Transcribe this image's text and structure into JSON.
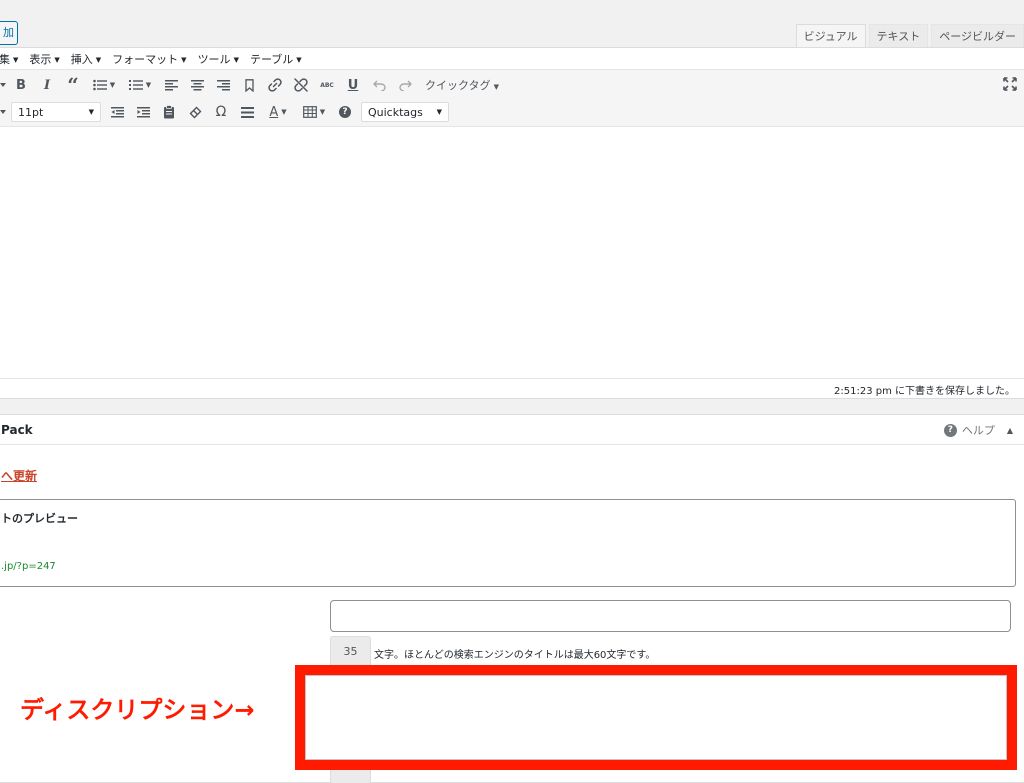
{
  "top": {
    "add_button": "加",
    "mode_tabs": [
      "ビジュアル",
      "テキスト",
      "ページビルダー"
    ],
    "active_mode": "ビジュアル"
  },
  "menubar": {
    "items": [
      "集",
      "表示",
      "挿入",
      "フォーマット",
      "ツール",
      "テーブル"
    ]
  },
  "toolbar": {
    "row1": {
      "icons": [
        "dropdown-icon",
        "bold-icon",
        "italic-icon",
        "blockquote-icon",
        "bullet-list-icon",
        "numbered-list-icon",
        "align-left-icon",
        "align-center-icon",
        "align-right-icon",
        "bookmark-icon",
        "link-icon",
        "unlink-icon",
        "spellcheck-icon",
        "underline-icon",
        "undo-icon",
        "redo-icon",
        "fullscreen-icon"
      ],
      "quicktag_label": "クイックタグ",
      "abc": "ABC",
      "bold": "B",
      "italic": "I",
      "quote": "“",
      "underline": "U"
    },
    "row2": {
      "font_size": "11pt",
      "omega": "Ω",
      "textcolor": "A",
      "help": "?",
      "quicktags_select": "Quicktags"
    }
  },
  "editor": {
    "save_status": "2:51:23 pm に下書きを保存しました。"
  },
  "seo_box": {
    "title": "Pack",
    "help_label": "ヘルプ",
    "help_icon": "?",
    "toggle": "▲",
    "update_link": "へ更新",
    "preview_title": "トのプレビュー",
    "preview_url": ".jp/?p=247",
    "title_char_count": "35",
    "title_hint": "文字。ほとんどの検索エンジンのタイトルは最大60文字です。"
  },
  "annotation": {
    "label": "ディスクリプション→",
    "color": "#ff1a00"
  }
}
